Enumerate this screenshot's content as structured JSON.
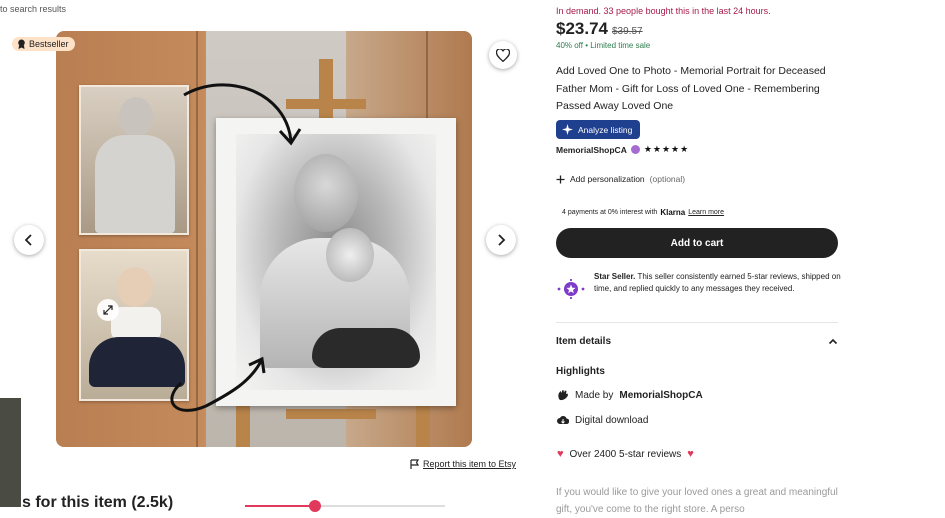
{
  "nav": {
    "back_label": "to search results"
  },
  "gallery": {
    "badge_label": "Bestseller",
    "favorite_icon": "heart-outline-icon",
    "prev_icon": "chevron-left-icon",
    "next_icon": "chevron-right-icon",
    "expand_icon": "expand-icon",
    "report_label": "Report this item to Etsy"
  },
  "reviews": {
    "heading": "s for this item (2.5k)",
    "rating_fill": 0.35
  },
  "product": {
    "demand_text": "In demand. 33 people bought this in the last 24 hours.",
    "price": "$23.74",
    "original_price": "$39.57",
    "discount_text": "40% off • Limited time sale",
    "title": "Add Loved One to Photo - Memorial Portrait for Deceased Father Mom - Gift for Loss of Loved One - Remembering Passed Away Loved One",
    "analyze_label": "Analyze listing",
    "shop_name": "MemorialShopCA",
    "rating_stars": "★★★★★",
    "personalization_label": "Add personalization",
    "personalization_optional": "(optional)",
    "klarna_text": "4 payments at 0% interest with",
    "klarna_brand": "Klarna",
    "klarna_link": "Learn more",
    "add_to_cart": "Add to cart",
    "star_seller_title": "Star Seller.",
    "star_seller_text": "This seller consistently earned 5-star reviews, shipped on time, and replied quickly to any messages they received."
  },
  "details": {
    "heading": "Item details",
    "highlights_heading": "Highlights",
    "made_by_prefix": "Made by",
    "made_by_shop": "MemorialShopCA",
    "download_label": "Digital download",
    "reviews_label": "Over 2400 5-star reviews",
    "description_preview": "If you would like to give your loved ones a great and meaningful gift, you've come to the right store. A perso"
  },
  "colors": {
    "accent_red": "#a61a4a",
    "cart_button": "#222222",
    "analyze_button": "#1f3f8f",
    "sale_green": "#2e7d4f"
  }
}
